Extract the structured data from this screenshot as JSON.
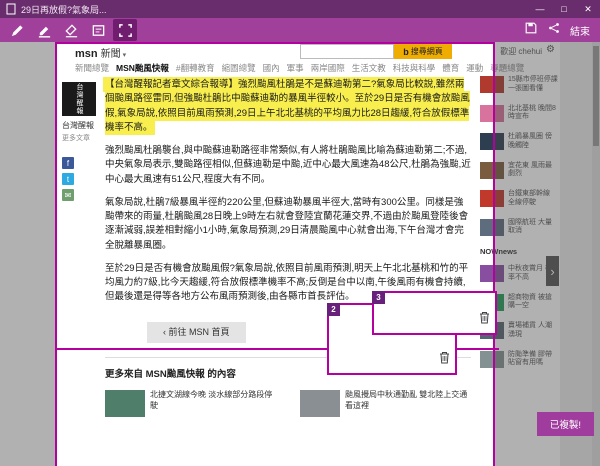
{
  "window": {
    "title": "29日再放假?氣象局...",
    "controls": {
      "minimize": "—",
      "maximize": "□",
      "close": "✕"
    }
  },
  "toolbar": {
    "tools": [
      "pen",
      "highlighter",
      "eraser",
      "typed-note",
      "clip"
    ],
    "selected_tool": "clip",
    "exit_label": "結束"
  },
  "colors": {
    "accent": "#b4009e",
    "titlebar": "#692d6e",
    "toolbar": "#a0409a",
    "highlight": "#f8ef4f",
    "toast": "#a03c9e"
  },
  "header": {
    "logo": "msn",
    "section": "新聞",
    "dropdown": "▾",
    "bing": "b",
    "search_button": "搜尋網頁",
    "welcome": "歡迎 chehui",
    "gear": "⚙"
  },
  "nav": {
    "items": [
      {
        "label": "新聞總覽",
        "selected": false
      },
      {
        "label": "MSN颱風快報",
        "selected": true
      },
      {
        "label": "#翻轉教育",
        "selected": false
      },
      {
        "label": "縮圖總覽",
        "selected": false
      },
      {
        "label": "國內",
        "selected": false
      },
      {
        "label": "軍事",
        "selected": false
      },
      {
        "label": "兩岸國際",
        "selected": false
      },
      {
        "label": "生活文教",
        "selected": false
      },
      {
        "label": "科技與科學",
        "selected": false
      },
      {
        "label": "體育",
        "selected": false
      },
      {
        "label": "運動",
        "selected": false
      },
      {
        "label": "專題總覽",
        "selected": false
      }
    ]
  },
  "publisher": {
    "name": "台灣醒報",
    "more_link": "更多文章"
  },
  "share": {
    "facebook": "f",
    "twitter": "t",
    "mail": "✉"
  },
  "article": {
    "lead": "【台灣醒報記者章文綜合報導】強烈颱風杜鵑是不是蘇迪勒第二?氣象局比較說,雖然兩個颱風路徑雷同,但強颱杜鵑比中颱蘇迪勒的暴風半徑較小。至於29日是否有機會放颱風假,氣象局說,依照目前風雨預測,29日上午北北基桃的平均風力比28日趨緩,符合放假標準機率不高。",
    "paragraphs": [
      "強烈颱風杜鵑襲台,與中颱蘇迪勒路徑非常類似,有人將杜鵑颱風比喻為蘇迪勒第二;不過,中央氣象局表示,雙颱路徑相似,但蘇迪勒是中颱,近中心最大風速為48公尺,杜鵑為強颱,近中心最大風速有51公尺,程度大有不同。",
      "氣象局說,杜鵑7級暴風半徑約220公里,但蘇迪勒暴風半徑大,當時有300公里。同樣是強颱帶來的雨量,杜鵑颱風28日晚上9時左右就會登陸宜蘭花蓮交界,不過由於颱風登陸後會逐漸減弱,誤差相對縮小1小時,氣象局預測,29日清晨颱風中心就會出海,下午台灣才會完全脫離暴風圈。",
      "至於29日是否有機會放颱風假?氣象局說,依照目前風雨預測,明天上午北北基桃和竹的平均風力約7級,比今天趨緩,符合放假標準機率不高;反倒是台中以南,午後風雨有機會持續,但最後還是得等各地方公布風雨預測後,由各縣市首長評估。"
    ],
    "back_chevron": "‹",
    "back_button": "前往 MSN 首頁",
    "more_heading": "更多來自 MSN颱風快報 的內容",
    "related": [
      {
        "title": "北捷文湖線今晚 淡水線部分路段停駛",
        "color": "#4f7f6a"
      },
      {
        "title": "颱風攪局中秋通勤亂 雙北陸上交通看這裡",
        "color": "#8a8f94"
      }
    ]
  },
  "right_rail": {
    "items": [
      {
        "title": "15縣市停班停課 一張圖看懂",
        "color": "#b03a2e"
      },
      {
        "title": "北北基桃 晚間8時宣布",
        "color": "#d7739c"
      },
      {
        "title": "杜鵑暴風圈 傍晚觸陸",
        "color": "#2c3e50"
      },
      {
        "title": "宜花東 風雨最劇烈",
        "color": "#7a5c3e"
      },
      {
        "title": "台鐵東部幹線 全線停駛",
        "color": "#c0392b"
      },
      {
        "title": "國際航班 大量取消",
        "color": "#5d6d7e"
      },
      {
        "title": "中秋夜賞月 機率不高",
        "color": "#884ea0"
      },
      {
        "title": "超商物資 被搶購一空",
        "color": "#239b56"
      },
      {
        "title": "賣場補貨 人潮湧現",
        "color": "#566573"
      },
      {
        "title": "防颱準備 膠帶貼窗有用嗎",
        "color": "#839192"
      }
    ],
    "source": "NOWnews",
    "next_arrow": "›"
  },
  "clipper": {
    "clips": [
      {
        "number": "2"
      },
      {
        "number": "3"
      }
    ],
    "copied_toast": "已複製!"
  }
}
